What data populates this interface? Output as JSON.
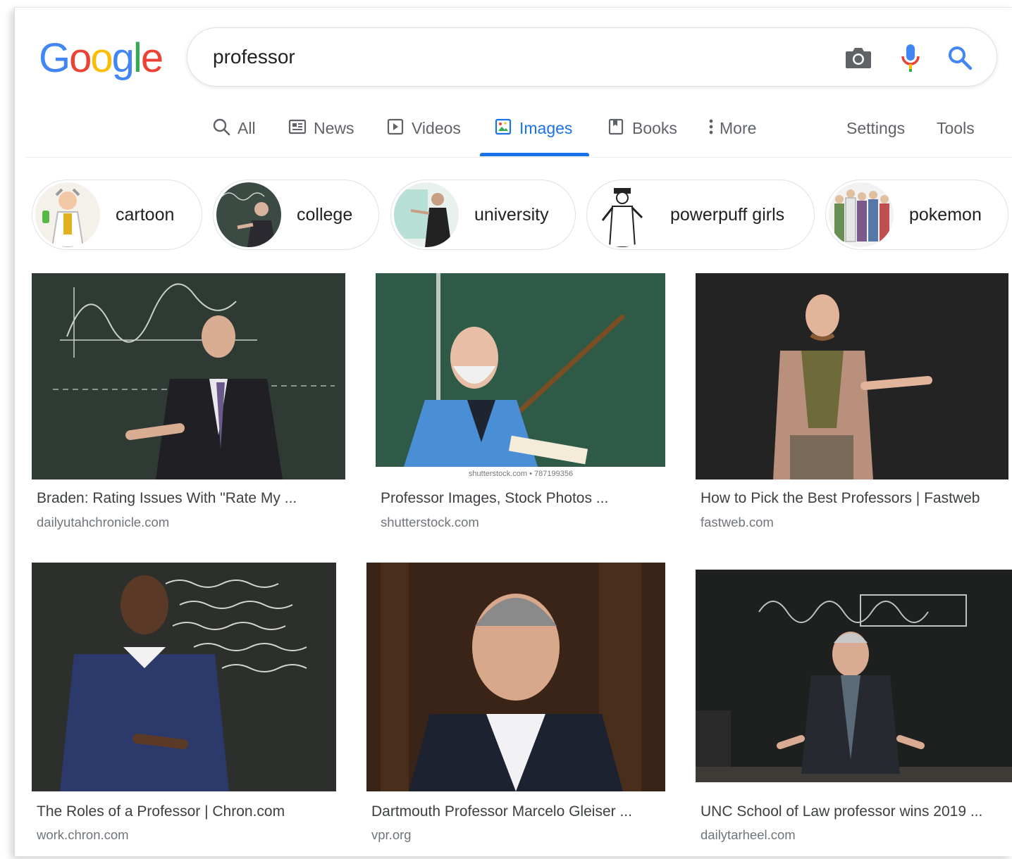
{
  "logo": {
    "letters": [
      "G",
      "o",
      "o",
      "g",
      "l",
      "e"
    ],
    "colors": [
      "#4285f4",
      "#ea4335",
      "#fbbc05",
      "#4285f4",
      "#34a853",
      "#ea4335"
    ]
  },
  "search": {
    "query": "professor",
    "icons": [
      "camera-icon",
      "microphone-icon",
      "search-icon"
    ]
  },
  "tabs": [
    {
      "label": "All",
      "icon": "search-icon"
    },
    {
      "label": "News",
      "icon": "newspaper-icon"
    },
    {
      "label": "Videos",
      "icon": "play-icon"
    },
    {
      "label": "Images",
      "icon": "image-icon",
      "active": true
    },
    {
      "label": "Books",
      "icon": "book-icon"
    },
    {
      "label": "More",
      "icon": "more-vert-icon"
    },
    {
      "label": "Settings"
    },
    {
      "label": "Tools"
    }
  ],
  "chips": [
    {
      "label": "cartoon"
    },
    {
      "label": "college"
    },
    {
      "label": "university"
    },
    {
      "label": "powerpuff girls"
    },
    {
      "label": "pokemon"
    }
  ],
  "results": [
    {
      "title": "Braden: Rating Issues With \"Rate My ...",
      "site": "dailyutahchronicle.com"
    },
    {
      "title": "Professor Images, Stock Photos ...",
      "site": "shutterstock.com",
      "watermark": "shutterstock.com • 787199356"
    },
    {
      "title": "How to Pick the Best Professors | Fastweb",
      "site": "fastweb.com"
    },
    {
      "title": "The Roles of a Professor | Chron.com",
      "site": "work.chron.com"
    },
    {
      "title": "Dartmouth Professor Marcelo Gleiser ...",
      "site": "vpr.org"
    },
    {
      "title": "UNC School of Law professor wins 2019 ...",
      "site": "dailytarheel.com"
    }
  ],
  "colors": {
    "accent": "#1a73e8",
    "text": "#202124",
    "muted": "#5f6368",
    "site": "#70757a"
  }
}
